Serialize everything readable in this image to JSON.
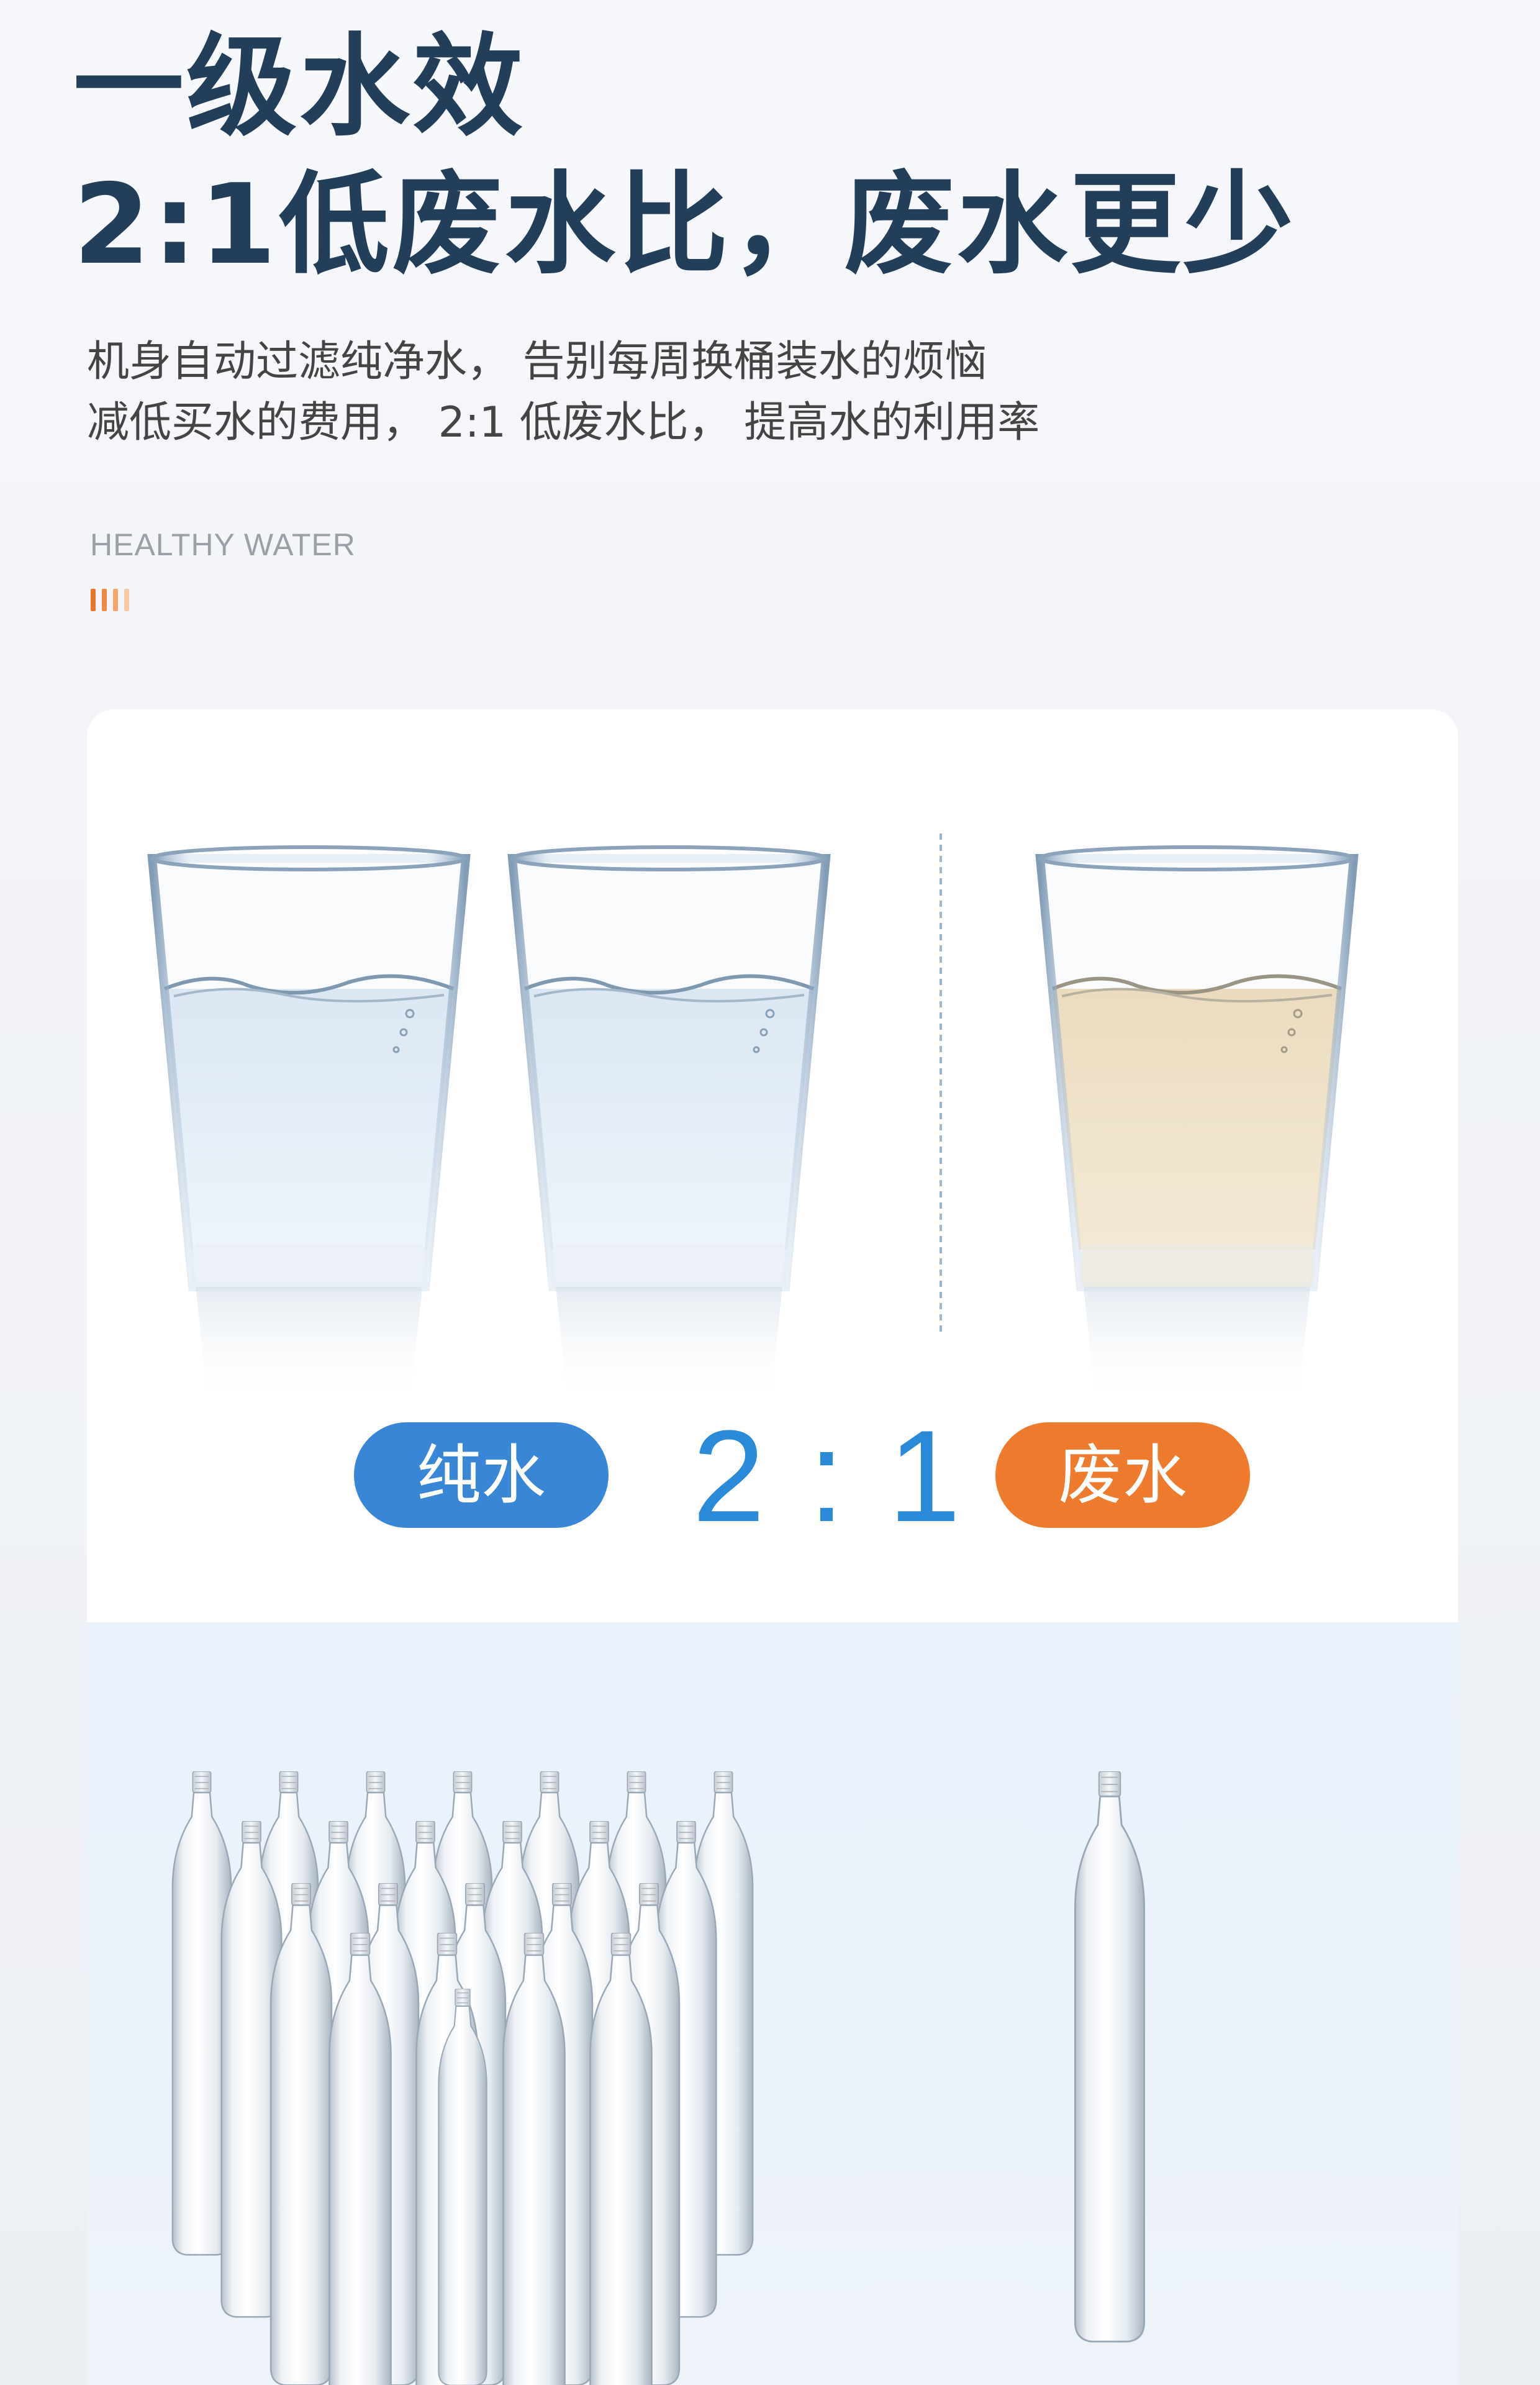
{
  "header": {
    "title_line1": "一级水效",
    "title_line2": "2:1低废水比，废水更少",
    "subtitle_line1": "机身自动过滤纯净水， 告别每周换桶装水的烦恼",
    "subtitle_line2": "减低买水的费用， 2:1 低废水比， 提高水的利用率",
    "english_tag": "HEALTHY WATER"
  },
  "comparison": {
    "pure_label": "纯水",
    "ratio": "2:1",
    "waste_label": "废水"
  },
  "colors": {
    "title": "#233e58",
    "pure_pill": "#3a86d6",
    "waste_pill": "#ee7a2e",
    "ratio": "#2a8ad8",
    "clear_water": "#e8f0f8",
    "waste_water": "#efe3c8"
  }
}
